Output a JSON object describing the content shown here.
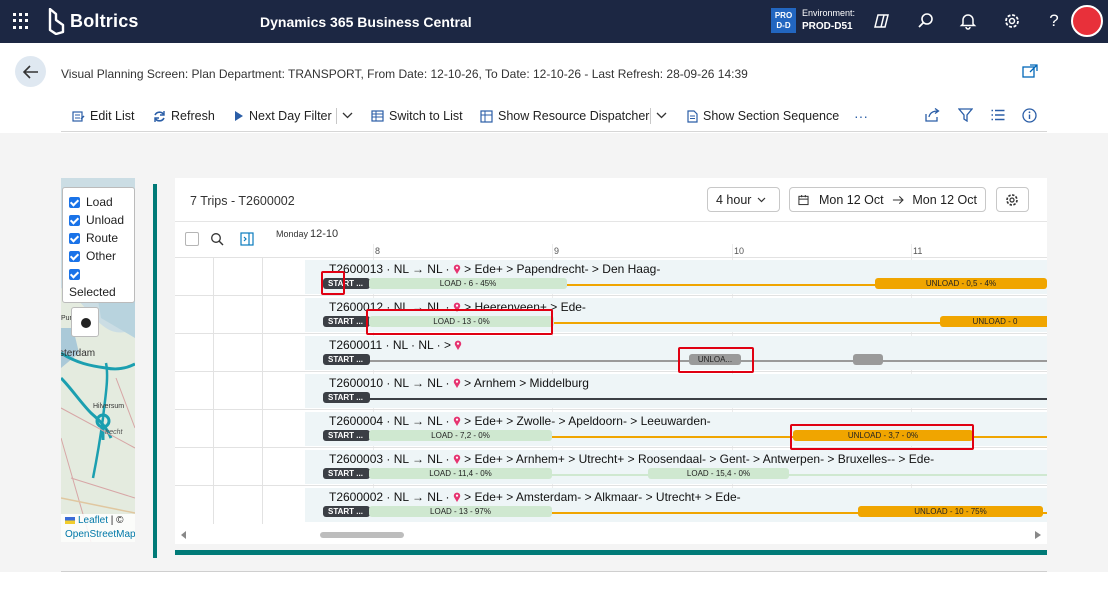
{
  "topbar": {
    "brand": "Boltrics",
    "product": "Dynamics 365 Business Central",
    "env_badge_line1": "PRO",
    "env_badge_line2": "D-D",
    "env_label": "Environment:",
    "env_name": "PROD-D51"
  },
  "header": {
    "title": "Visual Planning Screen: Plan Department: TRANSPORT, From Date: 12-10-26, To Date: 12-10-26 - Last Refresh: 28-09-26 14:39"
  },
  "actions": {
    "edit_list": "Edit List",
    "refresh": "Refresh",
    "next_day_filter": "Next Day Filter",
    "switch_to_list": "Switch to List",
    "show_resource_dispatcher": "Show Resource Dispatcher",
    "show_section_sequence": "Show Section Sequence",
    "more": "···"
  },
  "map": {
    "legend": [
      "Load",
      "Unload",
      "Route",
      "Other",
      "",
      "Selected"
    ],
    "places": [
      "Purmerend",
      "Amsterdam",
      "Hilversum",
      "Utrecht"
    ],
    "attribution_leaflet": "Leaflet",
    "attribution_sep": " | © ",
    "attribution_osm": "OpenStreetMap"
  },
  "planner": {
    "title": "7 Trips - T2600002",
    "zoom": "4 hour",
    "date_from": "Mon 12 Oct",
    "date_to": "Mon 12 Oct",
    "day_name": "Monday",
    "day_date": "12-10",
    "hours": [
      "8",
      "9",
      "10",
      "11"
    ],
    "rows": [
      {
        "label": "T2600013 · NL → NL · ",
        "route": " > Ede+ > Papendrecht- > Den Haag-",
        "segments": [
          {
            "type": "start",
            "text": "START ..."
          },
          {
            "type": "load",
            "text": "LOAD - 6 - 45%"
          },
          {
            "type": "unload",
            "text": "UNLOAD - 0,5 - 4%"
          }
        ]
      },
      {
        "label": "T2600012 · NL → NL · ",
        "route": " > Heerenveen+ > Ede-",
        "segments": [
          {
            "type": "start",
            "text": "START ..."
          },
          {
            "type": "load",
            "text": "LOAD - 13 - 0%"
          },
          {
            "type": "unload",
            "text": "UNLOAD - 0"
          }
        ]
      },
      {
        "label": "T2600011 · NL · NL · > ",
        "route": "",
        "segments": [
          {
            "type": "start",
            "text": "START ..."
          },
          {
            "type": "gray",
            "text": "UNLOA..."
          },
          {
            "type": "gray",
            "text": ""
          }
        ]
      },
      {
        "label": "T2600010 · NL → NL · ",
        "route": " > Arnhem > Middelburg",
        "segments": [
          {
            "type": "start",
            "text": "START ..."
          }
        ]
      },
      {
        "label": "T2600004 · NL → NL · ",
        "route": " > Ede+ > Zwolle- > Apeldoorn- > Leeuwarden-",
        "segments": [
          {
            "type": "start",
            "text": "START ..."
          },
          {
            "type": "load",
            "text": "LOAD - 7,2 - 0%"
          },
          {
            "type": "unload",
            "text": "UNLOAD - 3,7 - 0%"
          }
        ]
      },
      {
        "label": "T2600003 · NL → NL · ",
        "route": " > Ede+ > Arnhem+ > Utrecht+ > Roosendaal- > Gent- > Antwerpen- > Bruxelles-- > Ede-",
        "segments": [
          {
            "type": "start",
            "text": "START ..."
          },
          {
            "type": "load",
            "text": "LOAD - 11,4 - 0%"
          },
          {
            "type": "load",
            "text": "LOAD - 15,4 - 0%"
          }
        ]
      },
      {
        "label": "T2600002 · NL → NL · ",
        "route": " > Ede+ > Amsterdam- > Alkmaar- > Utrecht+ > Ede-",
        "segments": [
          {
            "type": "start",
            "text": "START ..."
          },
          {
            "type": "load",
            "text": "LOAD - 13 - 97%"
          },
          {
            "type": "unload",
            "text": "UNLOAD - 10 - 75%"
          }
        ]
      }
    ]
  },
  "colors": {
    "topbar": "#1c2743",
    "accent_teal": "#007a77",
    "unload": "#f0a500",
    "load": "#cfe8d0",
    "start": "#3b3f45",
    "highlight": "#e00012"
  }
}
